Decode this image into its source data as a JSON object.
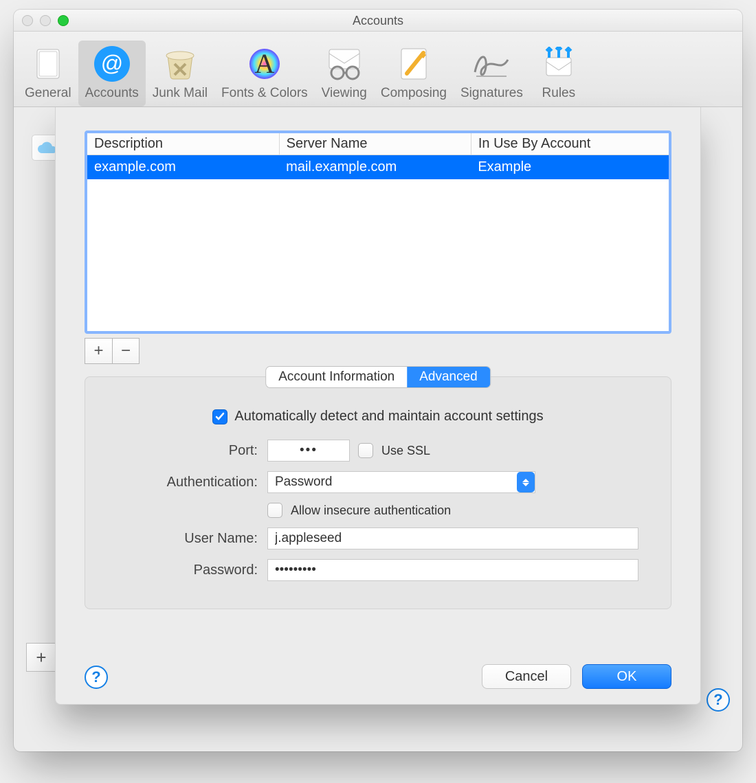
{
  "window": {
    "title": "Accounts"
  },
  "toolbar": {
    "items": [
      {
        "label": "General"
      },
      {
        "label": "Accounts"
      },
      {
        "label": "Junk Mail"
      },
      {
        "label": "Fonts & Colors"
      },
      {
        "label": "Viewing"
      },
      {
        "label": "Composing"
      },
      {
        "label": "Signatures"
      },
      {
        "label": "Rules"
      }
    ],
    "active": "Accounts"
  },
  "serverTable": {
    "headers": [
      "Description",
      "Server Name",
      "In Use By Account"
    ],
    "rows": [
      {
        "description": "example.com",
        "server": "mail.example.com",
        "account": "Example"
      }
    ]
  },
  "segTabs": {
    "a": "Account Information",
    "b": "Advanced",
    "active": "b"
  },
  "form": {
    "autosettings": {
      "label": "Automatically detect and maintain account settings",
      "checked": true
    },
    "port": {
      "label": "Port:",
      "value": "•••"
    },
    "ssl": {
      "label": "Use SSL",
      "checked": false
    },
    "auth": {
      "label": "Authentication:",
      "value": "Password"
    },
    "allowinsecure": {
      "label": "Allow insecure authentication",
      "checked": false
    },
    "username": {
      "label": "User Name:",
      "value": "j.appleseed"
    },
    "password": {
      "label": "Password:",
      "value": "•••••••••"
    }
  },
  "actions": {
    "cancel": "Cancel",
    "ok": "OK"
  },
  "misc": {
    "plus": "+",
    "minus": "−",
    "help": "?"
  }
}
